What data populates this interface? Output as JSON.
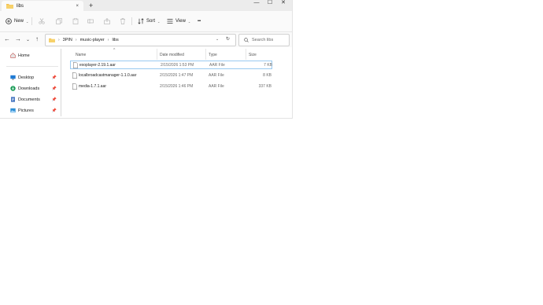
{
  "window": {
    "tab_title": "libs",
    "new_tab": "+",
    "tab_close": "×",
    "controls": {
      "minimize": "—",
      "maximize": "☐",
      "close": "✕"
    }
  },
  "toolbar": {
    "new_label": "New",
    "sort_label": "Sort",
    "view_label": "View",
    "more_label": "•••"
  },
  "address": {
    "crumbs": [
      "3PIN",
      "music-player",
      "libs"
    ],
    "search_placeholder": "Search libs"
  },
  "nav": {
    "home": "Home",
    "quick_access": [
      {
        "label": "Desktop",
        "icon": "desktop-icon"
      },
      {
        "label": "Downloads",
        "icon": "downloads-icon"
      },
      {
        "label": "Documents",
        "icon": "documents-icon"
      },
      {
        "label": "Pictures",
        "icon": "pictures-icon"
      }
    ]
  },
  "columns": {
    "name": "Name",
    "date": "Date modified",
    "type": "Type",
    "size": "Size"
  },
  "files": [
    {
      "name": "exoplayer-2.19.1.aar",
      "date": "2/15/2026 1:53 PM",
      "type": "AAR File",
      "size": "7 KB"
    },
    {
      "name": "localbroadcastmanager-1.1.0.aar",
      "date": "2/15/2026 1:47 PM",
      "type": "AAR File",
      "size": "8 KB"
    },
    {
      "name": "media-1.7.1.aar",
      "date": "2/15/2026 1:46 PM",
      "type": "AAR File",
      "size": "337 KB"
    }
  ],
  "colors": {
    "folder": "#f2c14e",
    "accent": "#0f6cbd",
    "selection_border": "#99c9f0"
  }
}
